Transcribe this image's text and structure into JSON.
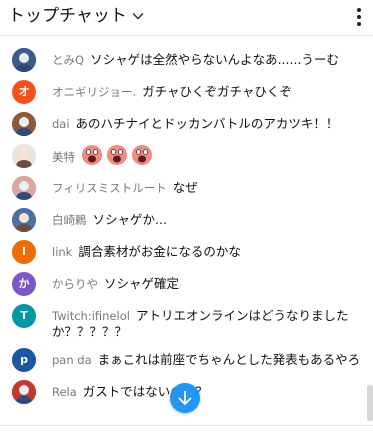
{
  "header": {
    "title": "トップチャット",
    "chevron_icon": "chevron-down-icon",
    "more_icon": "more-vert-icon"
  },
  "colors": {
    "scroll_button": "#2196f3",
    "author_text": "#7a7a7a"
  },
  "messages": [
    {
      "author": "とみQ",
      "text": "ソシャゲは全然やらないんよなあ......うーむ",
      "avatar_type": "image",
      "avatar_color": "#3b5b8a"
    },
    {
      "author": "オニギリジョー.",
      "text": "ガチャひくぞガチャひくぞ",
      "avatar_type": "letter",
      "avatar_letter": "オ",
      "avatar_color": "#f4511e"
    },
    {
      "author": "dai",
      "text": "あのハチナイとドッカンバトルのアカツキ！！",
      "avatar_type": "image",
      "avatar_color": "#8d5a3b"
    },
    {
      "author": "美特",
      "text": "",
      "avatar_type": "image",
      "avatar_color": "#e8e4dc",
      "emoji_count": 3,
      "emoji_icon": "screaming-face-emoji"
    },
    {
      "author": "フィリスミストルート",
      "text": "なぜ",
      "avatar_type": "image",
      "avatar_color": "#d9a7a0"
    },
    {
      "author": "白崎鶫",
      "text": "ソシャゲか...",
      "avatar_type": "image",
      "avatar_color": "#4d6fa3"
    },
    {
      "author": "link",
      "text": "調合素材がお金になるのかな",
      "avatar_type": "letter",
      "avatar_letter": "l",
      "avatar_color": "#ef6c00"
    },
    {
      "author": "からりや",
      "text": "ソシャゲ確定",
      "avatar_type": "letter",
      "avatar_letter": "か",
      "avatar_color": "#7e57c2"
    },
    {
      "author": "Twitch:ifinelol",
      "text": "アトリエオンラインはどうなりましたか？？？？？",
      "avatar_type": "letter",
      "avatar_letter": "T",
      "avatar_color": "#0097a7"
    },
    {
      "author": "pan da",
      "text": "まぁこれは前座でちゃんとした発表もあるやろ",
      "avatar_type": "letter",
      "avatar_letter": "p",
      "avatar_color": "#1e56a0"
    },
    {
      "author": "Rela",
      "text": "ガストではないのか？",
      "avatar_type": "image",
      "avatar_color": "#c0392b"
    }
  ],
  "scroll_button": {
    "icon": "arrow-down-icon"
  }
}
